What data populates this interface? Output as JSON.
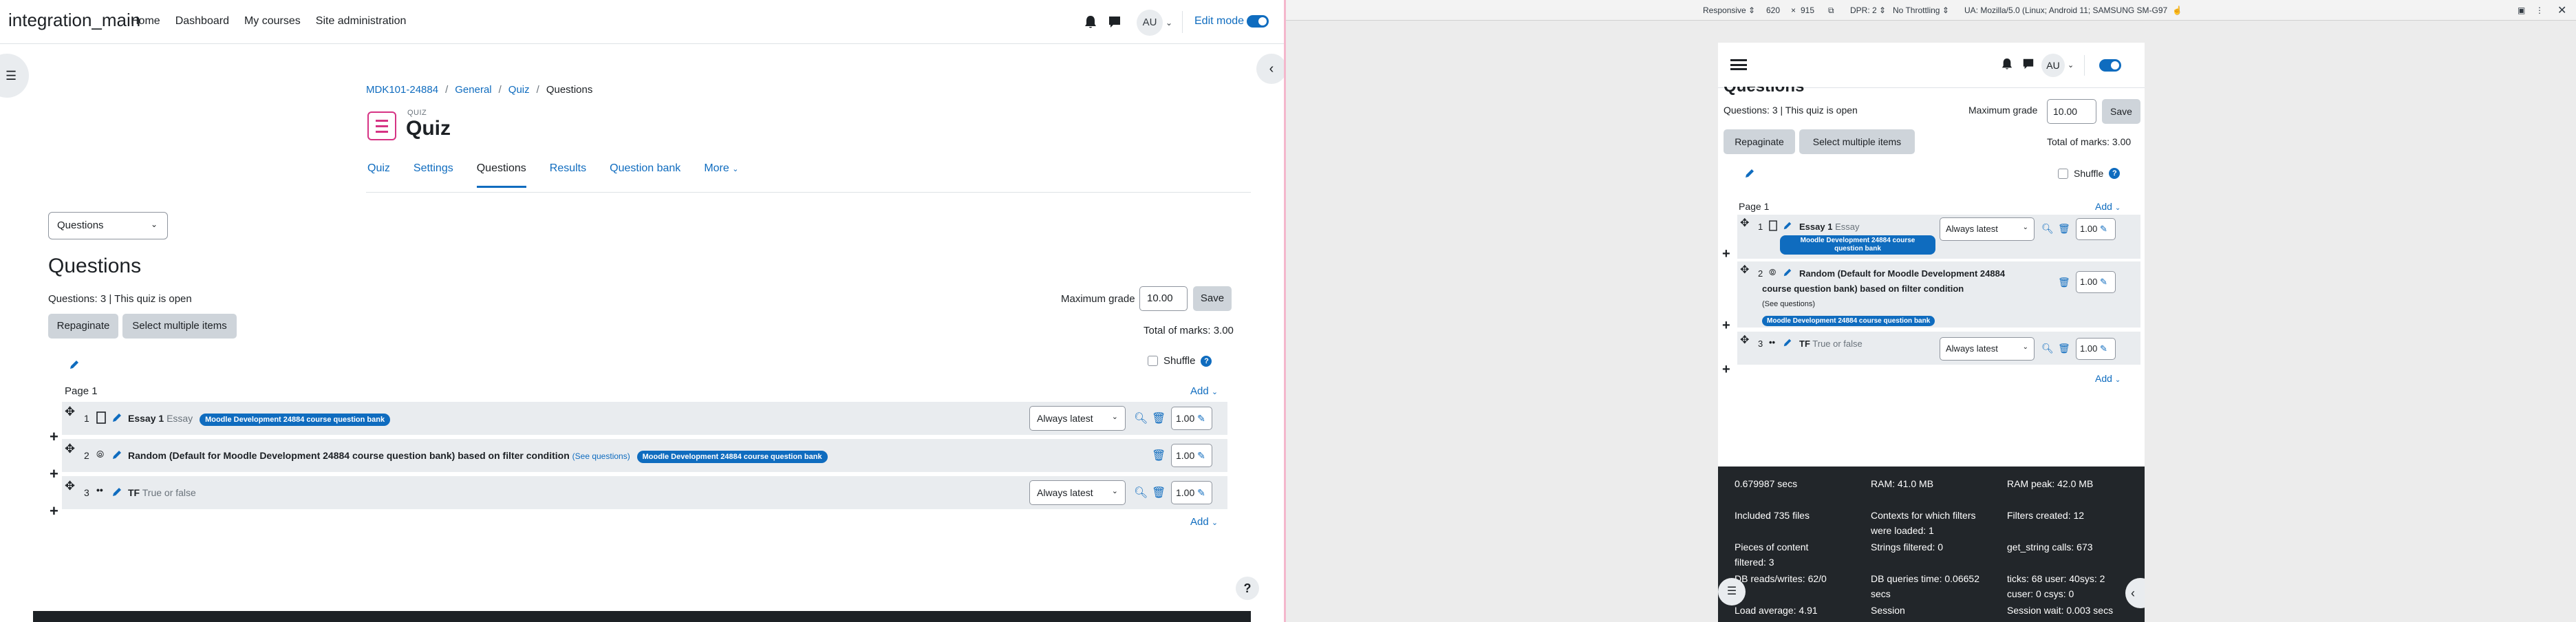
{
  "navbar": {
    "site_name": "integration_main",
    "links": [
      "Home",
      "Dashboard",
      "My courses",
      "Site administration"
    ],
    "avatar_initials": "AU",
    "edit_mode_label": "Edit mode"
  },
  "breadcrumb": [
    "MDK101-24884",
    "General",
    "Quiz",
    "Questions"
  ],
  "header": {
    "kicker": "QUIZ",
    "title": "Quiz"
  },
  "tabs": [
    "Quiz",
    "Settings",
    "Questions",
    "Results",
    "Question bank",
    "More"
  ],
  "active_tab": "Questions",
  "view_select": "Questions",
  "main": {
    "heading": "Questions",
    "info": "Questions: 3 | This quiz is open",
    "max_grade_label": "Maximum grade",
    "max_grade_value": "10.00",
    "save_label": "Save",
    "repaginate_label": "Repaginate",
    "select_multiple_label": "Select multiple items",
    "total_marks": "Total of marks: 3.00",
    "shuffle_label": "Shuffle",
    "page_label": "Page 1",
    "add_label": "Add",
    "questions": [
      {
        "num": "1",
        "name": "Essay 1",
        "type": "Essay",
        "bank": "Moodle Development 24884 course question bank",
        "version": "Always latest",
        "mark": "1.00"
      },
      {
        "num": "2",
        "name": "Random (Default for Moodle Development 24884 course question bank) based on filter condition",
        "see": "(See questions)",
        "bank": "Moodle Development 24884 course question bank",
        "mark": "1.00"
      },
      {
        "num": "3",
        "name": "TF",
        "type": "True or false",
        "version": "Always latest",
        "mark": "1.00"
      }
    ]
  },
  "devtools": {
    "device": "Responsive",
    "width": "620",
    "height": "915",
    "dpr": "DPR: 2",
    "throttle": "No Throttling",
    "ua": "UA: Mozilla/5.0 (Linux; Android 11; SAMSUNG SM-G97"
  },
  "mobile": {
    "cut_heading": "Questions",
    "bank_line1": "Moodle Development 24884 course",
    "bank_line2": "question bank",
    "random_line1": "Random (Default for Moodle Development 24884",
    "random_line2": "course question bank) based on filter condition"
  },
  "debug": {
    "secs": "0.679987 secs",
    "ram": "RAM: 41.0 MB",
    "ram_peak": "RAM peak: 42.0 MB",
    "included": "Included 735 files",
    "contexts_1": "Contexts for which filters",
    "contexts_2": "were loaded: 1",
    "filters_created": "Filters created: 12",
    "pieces_1": "Pieces of content",
    "pieces_2": "filtered: 3",
    "strings": "Strings filtered: 0",
    "get_string": "get_string calls: 673",
    "db_rw": "DB reads/writes: 62/0",
    "db_time_1": "DB queries time: 0.06652",
    "db_time_2": "secs",
    "ticks": "ticks: 68 user: 40sys: 2",
    "cuser": "cuser: 0 csys: 0",
    "load": "Load average: 4.91",
    "session": "Session",
    "session_wait": "Session wait: 0.003 secs"
  }
}
